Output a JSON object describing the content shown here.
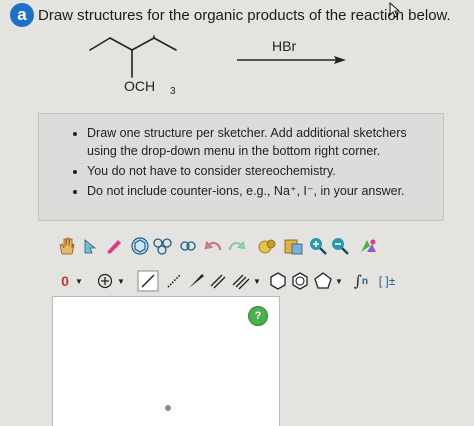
{
  "question": {
    "badge": "a",
    "text": "Draw structures for the organic products of the reaction below."
  },
  "reaction": {
    "substituent_label": "OCH",
    "substituent_subscript": "3",
    "reagent": "HBr"
  },
  "instructions": {
    "items": [
      "Draw one structure per sketcher. Add additional sketchers using the drop-down menu in the bottom right corner.",
      "You do not have to consider stereochemistry.",
      "Do not include counter-ions, e.g., Na⁺, I⁻, in your answer."
    ]
  },
  "toolbar2": {
    "charge_label": "0",
    "bracket_label": "[ ]±",
    "sn_label": "n"
  },
  "canvas": {
    "help_label": "?"
  },
  "colors": {
    "badge": "#1e6fc8",
    "help": "#4caf50",
    "pink_pen": "#e0358a",
    "teal": "#2a9aa8"
  }
}
